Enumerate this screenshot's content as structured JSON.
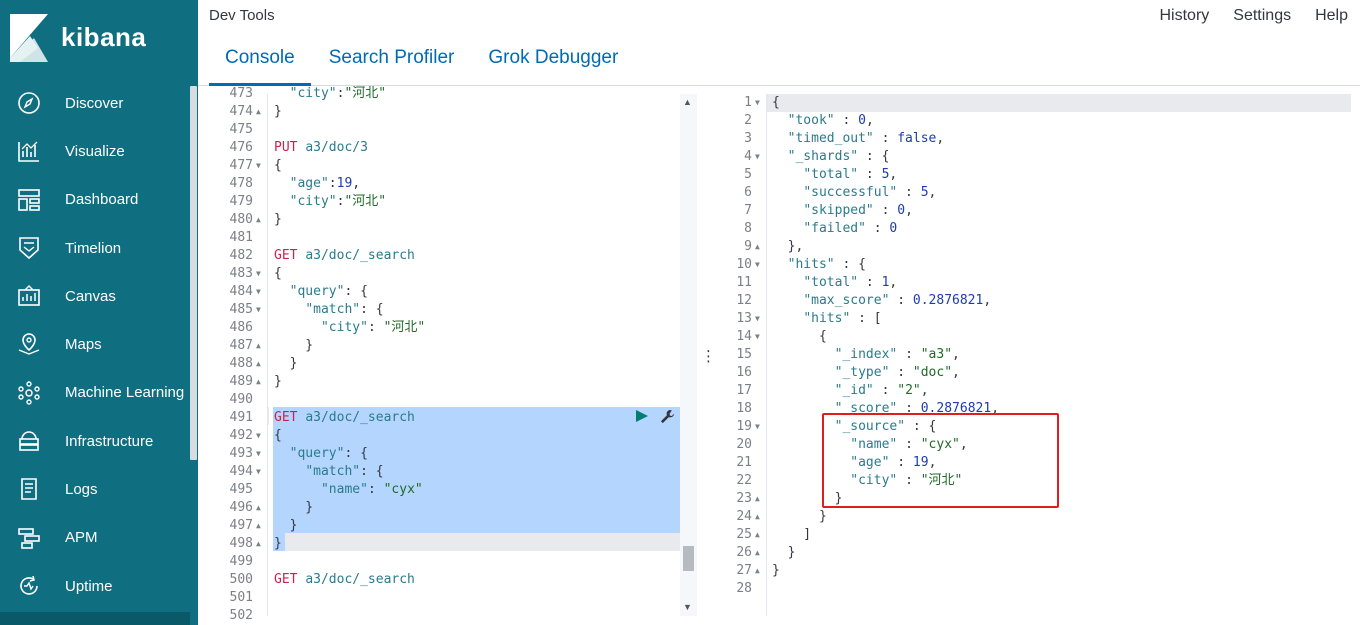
{
  "app": {
    "logo_text": "kibana",
    "title": "Dev Tools"
  },
  "top_links": [
    "History",
    "Settings",
    "Help"
  ],
  "tabs": [
    {
      "label": "Console",
      "active": true
    },
    {
      "label": "Search Profiler",
      "active": false
    },
    {
      "label": "Grok Debugger",
      "active": false
    }
  ],
  "nav": [
    {
      "label": "Discover",
      "icon": "compass-icon"
    },
    {
      "label": "Visualize",
      "icon": "visualize-icon"
    },
    {
      "label": "Dashboard",
      "icon": "dashboard-icon"
    },
    {
      "label": "Timelion",
      "icon": "timelion-icon"
    },
    {
      "label": "Canvas",
      "icon": "canvas-icon"
    },
    {
      "label": "Maps",
      "icon": "maps-icon"
    },
    {
      "label": "Machine Learning",
      "icon": "machine-learning-icon"
    },
    {
      "label": "Infrastructure",
      "icon": "infrastructure-icon"
    },
    {
      "label": "Logs",
      "icon": "logs-icon"
    },
    {
      "label": "APM",
      "icon": "apm-icon"
    },
    {
      "label": "Uptime",
      "icon": "uptime-icon"
    }
  ],
  "colors": {
    "sidebar": "#0f6e80",
    "accent": "#006bb4",
    "selection": "#b4d5fe",
    "highlight_box": "#e01e1e"
  },
  "request_editor": {
    "lines": [
      {
        "n": "473",
        "fold": "",
        "tokens": [
          [
            "k-key",
            "  \"city\""
          ],
          [
            "k-punc",
            ":"
          ],
          [
            "k-str",
            "\"河北\""
          ]
        ],
        "partial": true
      },
      {
        "n": "474",
        "fold": "up",
        "tokens": [
          [
            "k-punc",
            "}"
          ]
        ]
      },
      {
        "n": "475",
        "fold": "",
        "tokens": []
      },
      {
        "n": "476",
        "fold": "",
        "tokens": [
          [
            "k-method",
            "PUT"
          ],
          [
            "k-punc",
            " "
          ],
          [
            "k-path",
            "a3/doc/3"
          ]
        ]
      },
      {
        "n": "477",
        "fold": "down",
        "tokens": [
          [
            "k-punc",
            "{"
          ]
        ]
      },
      {
        "n": "478",
        "fold": "",
        "tokens": [
          [
            "k-punc",
            "  "
          ],
          [
            "k-key",
            "\"age\""
          ],
          [
            "k-punc",
            ":"
          ],
          [
            "k-num",
            "19"
          ],
          [
            "k-punc",
            ","
          ]
        ]
      },
      {
        "n": "479",
        "fold": "",
        "tokens": [
          [
            "k-punc",
            "  "
          ],
          [
            "k-key",
            "\"city\""
          ],
          [
            "k-punc",
            ":"
          ],
          [
            "k-str",
            "\"河北\""
          ]
        ]
      },
      {
        "n": "480",
        "fold": "up",
        "tokens": [
          [
            "k-punc",
            "}"
          ]
        ]
      },
      {
        "n": "481",
        "fold": "",
        "tokens": []
      },
      {
        "n": "482",
        "fold": "",
        "tokens": [
          [
            "k-method",
            "GET"
          ],
          [
            "k-punc",
            " "
          ],
          [
            "k-path",
            "a3/doc/_search"
          ]
        ]
      },
      {
        "n": "483",
        "fold": "down",
        "tokens": [
          [
            "k-punc",
            "{"
          ]
        ]
      },
      {
        "n": "484",
        "fold": "down",
        "tokens": [
          [
            "k-punc",
            "  "
          ],
          [
            "k-key",
            "\"query\""
          ],
          [
            "k-punc",
            ": {"
          ]
        ]
      },
      {
        "n": "485",
        "fold": "down",
        "tokens": [
          [
            "k-punc",
            "    "
          ],
          [
            "k-key",
            "\"match\""
          ],
          [
            "k-punc",
            ": {"
          ]
        ]
      },
      {
        "n": "486",
        "fold": "",
        "tokens": [
          [
            "k-punc",
            "      "
          ],
          [
            "k-key",
            "\"city\""
          ],
          [
            "k-punc",
            ": "
          ],
          [
            "k-str",
            "\"河北\""
          ]
        ]
      },
      {
        "n": "487",
        "fold": "up",
        "tokens": [
          [
            "k-punc",
            "    }"
          ]
        ]
      },
      {
        "n": "488",
        "fold": "up",
        "tokens": [
          [
            "k-punc",
            "  }"
          ]
        ]
      },
      {
        "n": "489",
        "fold": "up",
        "tokens": [
          [
            "k-punc",
            "}"
          ]
        ]
      },
      {
        "n": "490",
        "fold": "",
        "tokens": []
      },
      {
        "n": "491",
        "fold": "",
        "tokens": [
          [
            "k-method",
            "GET"
          ],
          [
            "k-punc",
            " "
          ],
          [
            "k-path",
            "a3/doc/_search"
          ]
        ]
      },
      {
        "n": "492",
        "fold": "down",
        "tokens": [
          [
            "k-punc",
            "{"
          ]
        ]
      },
      {
        "n": "493",
        "fold": "down",
        "tokens": [
          [
            "k-punc",
            "  "
          ],
          [
            "k-key",
            "\"query\""
          ],
          [
            "k-punc",
            ": {"
          ]
        ]
      },
      {
        "n": "494",
        "fold": "down",
        "tokens": [
          [
            "k-punc",
            "    "
          ],
          [
            "k-key",
            "\"match\""
          ],
          [
            "k-punc",
            ": {"
          ]
        ]
      },
      {
        "n": "495",
        "fold": "",
        "tokens": [
          [
            "k-punc",
            "      "
          ],
          [
            "k-key",
            "\"name\""
          ],
          [
            "k-punc",
            ": "
          ],
          [
            "k-str",
            "\"cyx\""
          ]
        ]
      },
      {
        "n": "496",
        "fold": "up",
        "tokens": [
          [
            "k-punc",
            "    }"
          ]
        ]
      },
      {
        "n": "497",
        "fold": "up",
        "tokens": [
          [
            "k-punc",
            "  }"
          ]
        ]
      },
      {
        "n": "498",
        "fold": "up",
        "tokens": [
          [
            "k-punc",
            "}"
          ]
        ]
      },
      {
        "n": "499",
        "fold": "",
        "tokens": []
      },
      {
        "n": "500",
        "fold": "",
        "tokens": [
          [
            "k-method",
            "GET"
          ],
          [
            "k-punc",
            " "
          ],
          [
            "k-path",
            "a3/doc/_search"
          ]
        ]
      },
      {
        "n": "501",
        "fold": "",
        "tokens": []
      },
      {
        "n": "502",
        "fold": "",
        "tokens": [],
        "partial": true
      }
    ]
  },
  "response_editor": {
    "lines": [
      {
        "n": "1",
        "fold": "down",
        "tokens": [
          [
            "k-punc",
            "{"
          ]
        ]
      },
      {
        "n": "2",
        "fold": "",
        "tokens": [
          [
            "k-punc",
            "  "
          ],
          [
            "k-key",
            "\"took\""
          ],
          [
            "k-punc",
            " : "
          ],
          [
            "k-num",
            "0"
          ],
          [
            "k-punc",
            ","
          ]
        ]
      },
      {
        "n": "3",
        "fold": "",
        "tokens": [
          [
            "k-punc",
            "  "
          ],
          [
            "k-key",
            "\"timed_out\""
          ],
          [
            "k-punc",
            " : "
          ],
          [
            "k-bool",
            "false"
          ],
          [
            "k-punc",
            ","
          ]
        ]
      },
      {
        "n": "4",
        "fold": "down",
        "tokens": [
          [
            "k-punc",
            "  "
          ],
          [
            "k-key",
            "\"_shards\""
          ],
          [
            "k-punc",
            " : {"
          ]
        ]
      },
      {
        "n": "5",
        "fold": "",
        "tokens": [
          [
            "k-punc",
            "    "
          ],
          [
            "k-key",
            "\"total\""
          ],
          [
            "k-punc",
            " : "
          ],
          [
            "k-num",
            "5"
          ],
          [
            "k-punc",
            ","
          ]
        ]
      },
      {
        "n": "6",
        "fold": "",
        "tokens": [
          [
            "k-punc",
            "    "
          ],
          [
            "k-key",
            "\"successful\""
          ],
          [
            "k-punc",
            " : "
          ],
          [
            "k-num",
            "5"
          ],
          [
            "k-punc",
            ","
          ]
        ]
      },
      {
        "n": "7",
        "fold": "",
        "tokens": [
          [
            "k-punc",
            "    "
          ],
          [
            "k-key",
            "\"skipped\""
          ],
          [
            "k-punc",
            " : "
          ],
          [
            "k-num",
            "0"
          ],
          [
            "k-punc",
            ","
          ]
        ]
      },
      {
        "n": "8",
        "fold": "",
        "tokens": [
          [
            "k-punc",
            "    "
          ],
          [
            "k-key",
            "\"failed\""
          ],
          [
            "k-punc",
            " : "
          ],
          [
            "k-num",
            "0"
          ]
        ]
      },
      {
        "n": "9",
        "fold": "up",
        "tokens": [
          [
            "k-punc",
            "  },"
          ]
        ]
      },
      {
        "n": "10",
        "fold": "down",
        "tokens": [
          [
            "k-punc",
            "  "
          ],
          [
            "k-key",
            "\"hits\""
          ],
          [
            "k-punc",
            " : {"
          ]
        ]
      },
      {
        "n": "11",
        "fold": "",
        "tokens": [
          [
            "k-punc",
            "    "
          ],
          [
            "k-key",
            "\"total\""
          ],
          [
            "k-punc",
            " : "
          ],
          [
            "k-num",
            "1"
          ],
          [
            "k-punc",
            ","
          ]
        ]
      },
      {
        "n": "12",
        "fold": "",
        "tokens": [
          [
            "k-punc",
            "    "
          ],
          [
            "k-key",
            "\"max_score\""
          ],
          [
            "k-punc",
            " : "
          ],
          [
            "k-num",
            "0.2876821"
          ],
          [
            "k-punc",
            ","
          ]
        ]
      },
      {
        "n": "13",
        "fold": "down",
        "tokens": [
          [
            "k-punc",
            "    "
          ],
          [
            "k-key",
            "\"hits\""
          ],
          [
            "k-punc",
            " : ["
          ]
        ]
      },
      {
        "n": "14",
        "fold": "down",
        "tokens": [
          [
            "k-punc",
            "      {"
          ]
        ]
      },
      {
        "n": "15",
        "fold": "",
        "tokens": [
          [
            "k-punc",
            "        "
          ],
          [
            "k-key",
            "\"_index\""
          ],
          [
            "k-punc",
            " : "
          ],
          [
            "k-str",
            "\"a3\""
          ],
          [
            "k-punc",
            ","
          ]
        ]
      },
      {
        "n": "16",
        "fold": "",
        "tokens": [
          [
            "k-punc",
            "        "
          ],
          [
            "k-key",
            "\"_type\""
          ],
          [
            "k-punc",
            " : "
          ],
          [
            "k-str",
            "\"doc\""
          ],
          [
            "k-punc",
            ","
          ]
        ]
      },
      {
        "n": "17",
        "fold": "",
        "tokens": [
          [
            "k-punc",
            "        "
          ],
          [
            "k-key",
            "\"_id\""
          ],
          [
            "k-punc",
            " : "
          ],
          [
            "k-str",
            "\"2\""
          ],
          [
            "k-punc",
            ","
          ]
        ]
      },
      {
        "n": "18",
        "fold": "",
        "tokens": [
          [
            "k-punc",
            "        "
          ],
          [
            "k-key",
            "\"_score\""
          ],
          [
            "k-punc",
            " : "
          ],
          [
            "k-num",
            "0.2876821"
          ],
          [
            "k-punc",
            ","
          ]
        ]
      },
      {
        "n": "19",
        "fold": "down",
        "tokens": [
          [
            "k-punc",
            "        "
          ],
          [
            "k-key",
            "\"_source\""
          ],
          [
            "k-punc",
            " : {"
          ]
        ]
      },
      {
        "n": "20",
        "fold": "",
        "tokens": [
          [
            "k-punc",
            "          "
          ],
          [
            "k-key",
            "\"name\""
          ],
          [
            "k-punc",
            " : "
          ],
          [
            "k-str",
            "\"cyx\""
          ],
          [
            "k-punc",
            ","
          ]
        ]
      },
      {
        "n": "21",
        "fold": "",
        "tokens": [
          [
            "k-punc",
            "          "
          ],
          [
            "k-key",
            "\"age\""
          ],
          [
            "k-punc",
            " : "
          ],
          [
            "k-num",
            "19"
          ],
          [
            "k-punc",
            ","
          ]
        ]
      },
      {
        "n": "22",
        "fold": "",
        "tokens": [
          [
            "k-punc",
            "          "
          ],
          [
            "k-key",
            "\"city\""
          ],
          [
            "k-punc",
            " : "
          ],
          [
            "k-str",
            "\"河北\""
          ]
        ]
      },
      {
        "n": "23",
        "fold": "up",
        "tokens": [
          [
            "k-punc",
            "        }"
          ]
        ]
      },
      {
        "n": "24",
        "fold": "up",
        "tokens": [
          [
            "k-punc",
            "      }"
          ]
        ]
      },
      {
        "n": "25",
        "fold": "up",
        "tokens": [
          [
            "k-punc",
            "    ]"
          ]
        ]
      },
      {
        "n": "26",
        "fold": "up",
        "tokens": [
          [
            "k-punc",
            "  }"
          ]
        ]
      },
      {
        "n": "27",
        "fold": "up",
        "tokens": [
          [
            "k-punc",
            "}"
          ]
        ]
      },
      {
        "n": "28",
        "fold": "",
        "tokens": []
      }
    ]
  }
}
